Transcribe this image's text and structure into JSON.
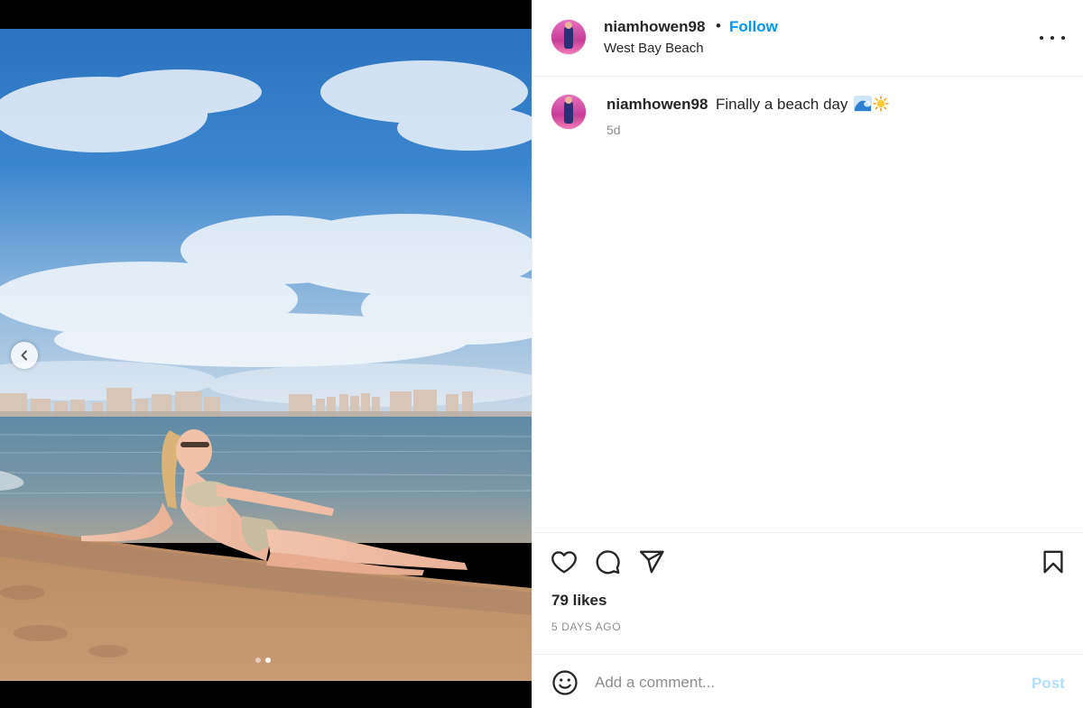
{
  "post": {
    "username": "niamhowen98",
    "separator": "•",
    "follow_label": "Follow",
    "location": "West Bay Beach",
    "more_icon": "more-horizontal-icon"
  },
  "caption": {
    "username": "niamhowen98",
    "text": "Finally a beach day",
    "emoji": [
      "🌊",
      "☀️"
    ],
    "time": "5d"
  },
  "engagement": {
    "likes": "79 likes",
    "posted_ago": "5 DAYS AGO"
  },
  "comment": {
    "placeholder": "Add a comment...",
    "post_label": "Post"
  },
  "carousel": {
    "current_slide": 2,
    "total_slides": 2
  },
  "icons": {
    "like": "heart-icon",
    "comment": "comment-bubble-icon",
    "share": "paper-plane-icon",
    "save": "bookmark-icon",
    "emoji": "smiley-icon",
    "previous": "chevron-left-icon"
  },
  "colors": {
    "accent": "#0095f6",
    "post_disabled": "#b2dffc",
    "muted": "#8e8e8e",
    "text": "#262626"
  }
}
